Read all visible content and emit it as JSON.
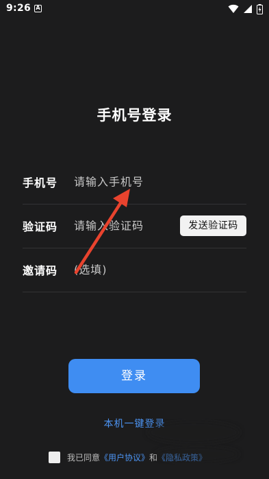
{
  "status_bar": {
    "time": "9:26",
    "notification_badge": "A",
    "icons": [
      "wifi-icon",
      "signal-icon",
      "battery-icon"
    ]
  },
  "title": "手机号登录",
  "form": {
    "phone": {
      "label": "手机号",
      "placeholder": "请输入手机号"
    },
    "code": {
      "label": "验证码",
      "placeholder": "请输入验证码",
      "send_button": "发送验证码"
    },
    "invite": {
      "label": "邀请码",
      "placeholder": "(选填)"
    }
  },
  "login_button": "登录",
  "one_key_login": "本机一键登录",
  "agreement": {
    "prefix": "我已同意",
    "user_agreement": "《用户协议》",
    "and": "和",
    "privacy_policy": "《隐私政策》"
  },
  "colors": {
    "background": "#1c1c1d",
    "accent": "#3f8df2",
    "link": "#4c94f3",
    "annotation_arrow": "#e8432e"
  }
}
